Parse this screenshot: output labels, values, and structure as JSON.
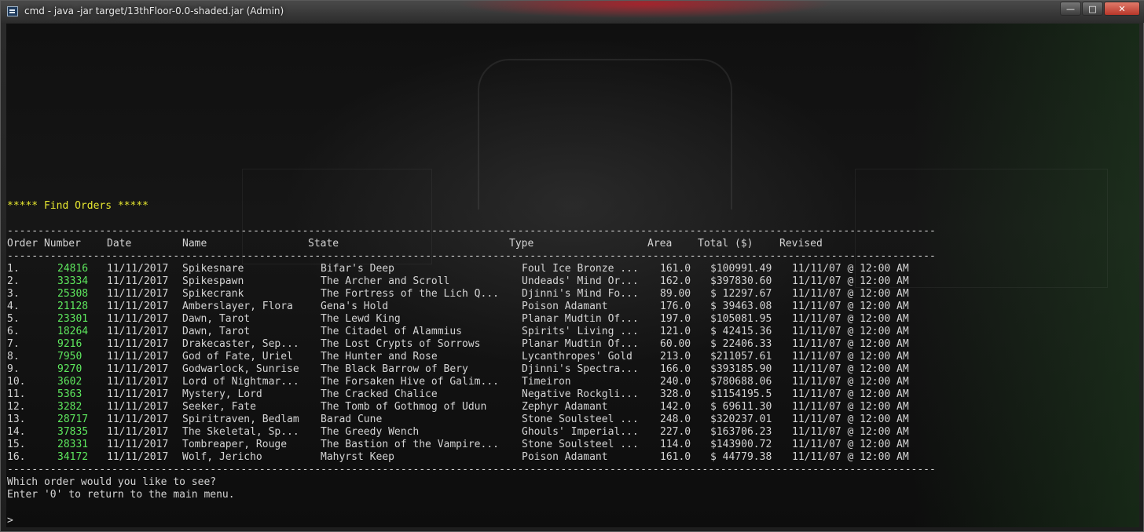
{
  "window": {
    "title": "cmd - java  -jar target/13thFloor-0.0-shaded.jar (Admin)",
    "min_label": "—",
    "max_label": "□",
    "close_label": "✕"
  },
  "console": {
    "heading": "***** Find Orders *****",
    "separator": "----------------------------------------------------------------------------------------------------------------------------------------------------------------",
    "columns": {
      "order_number": "Order Number",
      "date": "Date",
      "name": "Name",
      "state": "State",
      "type": "Type",
      "area": "Area",
      "total": "Total ($)",
      "revised": "Revised"
    },
    "rows": [
      {
        "idx": "1.",
        "num": "24816",
        "date": "11/11/2017",
        "name": "Spikesnare",
        "state": "Bifar's Deep",
        "type": "Foul Ice Bronze ...",
        "area": "161.0",
        "total": "$100991.49",
        "revised": "11/11/07 @ 12:00 AM"
      },
      {
        "idx": "2.",
        "num": "33334",
        "date": "11/11/2017",
        "name": "Spikespawn",
        "state": "The Archer and Scroll",
        "type": "Undeads' Mind Or...",
        "area": "162.0",
        "total": "$397830.60",
        "revised": "11/11/07 @ 12:00 AM"
      },
      {
        "idx": "3.",
        "num": "25308",
        "date": "11/11/2017",
        "name": "Spikecrank",
        "state": "The Fortress of the Lich Q...",
        "type": "Djinni's Mind Fo...",
        "area": "89.00",
        "total": "$ 12297.67",
        "revised": "11/11/07 @ 12:00 AM"
      },
      {
        "idx": "4.",
        "num": "21128",
        "date": "11/11/2017",
        "name": "Amberslayer, Flora",
        "state": "Gena's Hold",
        "type": "Poison Adamant",
        "area": "176.0",
        "total": "$ 39463.08",
        "revised": "11/11/07 @ 12:00 AM"
      },
      {
        "idx": "5.",
        "num": "23301",
        "date": "11/11/2017",
        "name": "Dawn, Tarot",
        "state": "The Lewd King",
        "type": "Planar Mudtin Of...",
        "area": "197.0",
        "total": "$105081.95",
        "revised": "11/11/07 @ 12:00 AM"
      },
      {
        "idx": "6.",
        "num": "18264",
        "date": "11/11/2017",
        "name": "Dawn, Tarot",
        "state": "The Citadel of Alammius",
        "type": "Spirits' Living ...",
        "area": "121.0",
        "total": "$ 42415.36",
        "revised": "11/11/07 @ 12:00 AM"
      },
      {
        "idx": "7.",
        "num": "9216",
        "date": "11/11/2017",
        "name": "Drakecaster, Sep...",
        "state": "The Lost Crypts of Sorrows",
        "type": "Planar Mudtin Of...",
        "area": "60.00",
        "total": "$ 22406.33",
        "revised": "11/11/07 @ 12:00 AM"
      },
      {
        "idx": "8.",
        "num": "7950",
        "date": "11/11/2017",
        "name": "God of Fate, Uriel",
        "state": "The Hunter and Rose",
        "type": "Lycanthropes' Gold",
        "area": "213.0",
        "total": "$211057.61",
        "revised": "11/11/07 @ 12:00 AM"
      },
      {
        "idx": "9.",
        "num": "9270",
        "date": "11/11/2017",
        "name": "Godwarlock, Sunrise",
        "state": "The Black Barrow of Bery",
        "type": "Djinni's Spectra...",
        "area": "166.0",
        "total": "$393185.90",
        "revised": "11/11/07 @ 12:00 AM"
      },
      {
        "idx": "10.",
        "num": "3602",
        "date": "11/11/2017",
        "name": "Lord of Nightmar...",
        "state": "The Forsaken Hive of Galim...",
        "type": "Timeiron",
        "area": "240.0",
        "total": "$780688.06",
        "revised": "11/11/07 @ 12:00 AM"
      },
      {
        "idx": "11.",
        "num": "5363",
        "date": "11/11/2017",
        "name": "Mystery, Lord",
        "state": "The Cracked Chalice",
        "type": "Negative Rockgli...",
        "area": "328.0",
        "total": "$1154195.5",
        "revised": "11/11/07 @ 12:00 AM"
      },
      {
        "idx": "12.",
        "num": "3282",
        "date": "11/11/2017",
        "name": "Seeker, Fate",
        "state": "The Tomb of Gothmog of Udun",
        "type": "Zephyr Adamant",
        "area": "142.0",
        "total": "$ 69611.30",
        "revised": "11/11/07 @ 12:00 AM"
      },
      {
        "idx": "13.",
        "num": "28717",
        "date": "11/11/2017",
        "name": "Spiritraven, Bedlam",
        "state": "Barad Cune",
        "type": "Stone Soulsteel ...",
        "area": "248.0",
        "total": "$320237.01",
        "revised": "11/11/07 @ 12:00 AM"
      },
      {
        "idx": "14.",
        "num": "37835",
        "date": "11/11/2017",
        "name": "The Skeletal, Sp...",
        "state": "The Greedy Wench",
        "type": "Ghouls' Imperial...",
        "area": "227.0",
        "total": "$163706.23",
        "revised": "11/11/07 @ 12:00 AM"
      },
      {
        "idx": "15.",
        "num": "28331",
        "date": "11/11/2017",
        "name": "Tombreaper, Rouge",
        "state": "The Bastion of the Vampire...",
        "type": "Stone Soulsteel ...",
        "area": "114.0",
        "total": "$143900.72",
        "revised": "11/11/07 @ 12:00 AM"
      },
      {
        "idx": "16.",
        "num": "34172",
        "date": "11/11/2017",
        "name": "Wolf, Jericho",
        "state": "Mahyrst Keep",
        "type": "Poison Adamant",
        "area": "161.0",
        "total": "$ 44779.38",
        "revised": "11/11/07 @ 12:00 AM"
      }
    ],
    "question": "Which order would you like to see?",
    "hint": "Enter '0' to return to the main menu.",
    "prompt": ">"
  },
  "colors": {
    "heading": "#e8e830",
    "order_number": "#5ee85e",
    "text": "#d4d4d4",
    "title_glow": "#b4141e"
  }
}
